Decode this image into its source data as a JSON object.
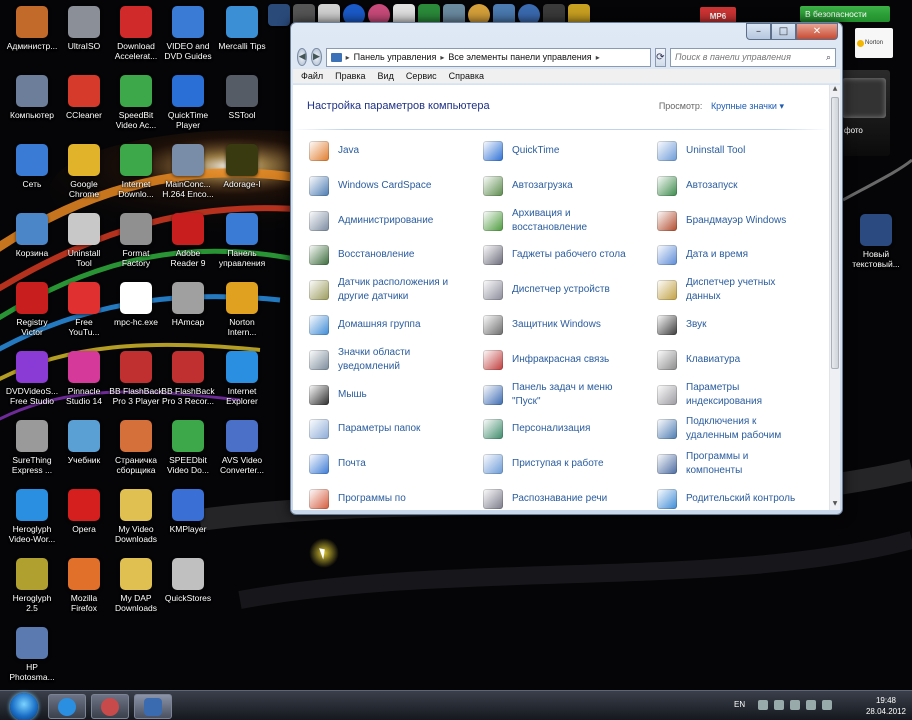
{
  "desktop": {
    "icons": [
      {
        "label": "Администр...",
        "color": "#c26a2a"
      },
      {
        "label": "UltraISO",
        "color": "#8b8f98"
      },
      {
        "label": "Download\nAccelerat...",
        "color": "#d12a2a"
      },
      {
        "label": "VIDEO and\nDVD Guides",
        "color": "#3a7bd5"
      },
      {
        "label": "Mercalli Tips",
        "color": "#3a8fd5"
      },
      {
        "label": "Компьютер",
        "color": "#6c7e99"
      },
      {
        "label": "CCleaner",
        "color": "#d53a2a"
      },
      {
        "label": "SpeedBit\nVideo Ac...",
        "color": "#3ca84a"
      },
      {
        "label": "QuickTime\nPlayer",
        "color": "#2a6fd5"
      },
      {
        "label": "SSTool",
        "color": "#555c66"
      },
      {
        "label": "Сеть",
        "color": "#3a7bd5"
      },
      {
        "label": "Google\nChrome",
        "color": "#e0b32a"
      },
      {
        "label": "Internet\nDownlo...",
        "color": "#3ca84a"
      },
      {
        "label": "MainConc...\nH.264 Enco...",
        "color": "#7a8da8"
      },
      {
        "label": "Adorage-I",
        "color": "#3a3a10"
      },
      {
        "label": "Корзина",
        "color": "#4a86c8"
      },
      {
        "label": "Uninstall\nTool",
        "color": "#c8c8c8"
      },
      {
        "label": "Format\nFactory",
        "color": "#909090"
      },
      {
        "label": "Adobe\nReader 9",
        "color": "#c81e1e"
      },
      {
        "label": "Панель\nуправления",
        "color": "#3a7bd5"
      },
      {
        "label": "Registry\nVictor",
        "color": "#c81e1e"
      },
      {
        "label": "Free\nYouTu...",
        "color": "#e03030"
      },
      {
        "label": "mpc-hc.exe",
        "color": "#ffffff"
      },
      {
        "label": "HAmcap",
        "color": "#a0a0a0"
      },
      {
        "label": "Norton\nIntern...",
        "color": "#e0a020"
      },
      {
        "label": "DVDVideoS...\nFree Studio",
        "color": "#8a3ad5"
      },
      {
        "label": "Pinnacle\nStudio 14",
        "color": "#d53a9a"
      },
      {
        "label": "BB FlashBack\nPro 3 Player",
        "color": "#c03030"
      },
      {
        "label": "BB FlashBack\nPro 3 Recor...",
        "color": "#c03030"
      },
      {
        "label": "Internet\nExplorer",
        "color": "#2a8fe0"
      },
      {
        "label": "SureThing\nExpress ...",
        "color": "#9a9a9a"
      },
      {
        "label": "Учебник",
        "color": "#5aa0d5"
      },
      {
        "label": "Страничка\nсборщика",
        "color": "#d5703a"
      },
      {
        "label": "SPEEDbit\nVideo Do...",
        "color": "#3ca84a"
      },
      {
        "label": "AVS Video\nConverter...",
        "color": "#4a70c8"
      },
      {
        "label": "Heroglyph\nVideo-Wor...",
        "color": "#2a8fe0"
      },
      {
        "label": "Opera",
        "color": "#d51e1e"
      },
      {
        "label": "My Video\nDownloads",
        "color": "#e0c050"
      },
      {
        "label": "KMPlayer",
        "color": "#3a6fd5"
      },
      {
        "label": "Heroglyph\n2.5",
        "color": "#b0a030"
      },
      {
        "label": "Mozilla\nFirefox",
        "color": "#e0702a"
      },
      {
        "label": "My DAP\nDownloads",
        "color": "#e0c050"
      },
      {
        "label": "QuickStores",
        "color": "#c0c0c0"
      },
      {
        "label": "HP\nPhotosma...",
        "color": "#5a7ab0"
      }
    ],
    "right_icon": {
      "label": "Новый\nтекстовый...",
      "color": "#2b4b80"
    },
    "security_badge": "В безопасности",
    "norton_label": "Norton",
    "mp6_label": "MP6",
    "photo_label": "фото"
  },
  "window": {
    "address": {
      "crumb1": "Панель управления",
      "crumb2": "Все элементы панели управления"
    },
    "search_placeholder": "Поиск в панели управления",
    "menu": [
      "Файл",
      "Правка",
      "Вид",
      "Сервис",
      "Справка"
    ],
    "title": "Настройка параметров компьютера",
    "view_by_label": "Просмотр:",
    "view_by_value": "Крупные значки",
    "items": [
      {
        "label": "Java",
        "color": "#e07a2a"
      },
      {
        "label": "QuickTime",
        "color": "#2a6fd5"
      },
      {
        "label": "Uninstall Tool",
        "color": "#6a9ad5"
      },
      {
        "label": "Windows CardSpace",
        "color": "#4a7ab0"
      },
      {
        "label": "Автозагрузка",
        "color": "#5a8a4a"
      },
      {
        "label": "Автозапуск",
        "color": "#3a8a4a"
      },
      {
        "label": "Администрирование",
        "color": "#7a8aa0"
      },
      {
        "label": "Архивация и\nвосстановление",
        "color": "#4a9a3a"
      },
      {
        "label": "Брандмауэр Windows",
        "color": "#b04a2a"
      },
      {
        "label": "Восстановление",
        "color": "#3a6a3a"
      },
      {
        "label": "Гаджеты рабочего стола",
        "color": "#6a6a7a"
      },
      {
        "label": "Дата и время",
        "color": "#5a8ad5"
      },
      {
        "label": "Датчик расположения и\nдругие датчики",
        "color": "#9a9a5a"
      },
      {
        "label": "Диспетчер устройств",
        "color": "#8a8a9a"
      },
      {
        "label": "Диспетчер учетных\nданных",
        "color": "#c0a040"
      },
      {
        "label": "Домашняя группа",
        "color": "#3a8ad5"
      },
      {
        "label": "Защитник Windows",
        "color": "#6a6a6a"
      },
      {
        "label": "Звук",
        "color": "#3a3a3a"
      },
      {
        "label": "Значки области\nуведомлений",
        "color": "#7a8a9a"
      },
      {
        "label": "Инфракрасная связь",
        "color": "#c03a3a"
      },
      {
        "label": "Клавиатура",
        "color": "#8a8a8a"
      },
      {
        "label": "Мышь",
        "color": "#2a2a2a"
      },
      {
        "label": "Панель задач и меню\n\"Пуск\"",
        "color": "#3a6ab0"
      },
      {
        "label": "Параметры\nиндексирования",
        "color": "#9a9aa0"
      },
      {
        "label": "Параметры папок",
        "color": "#8aaad5"
      },
      {
        "label": "Персонализация",
        "color": "#3a8a6a"
      },
      {
        "label": "Подключения к\nудаленным рабочим",
        "color": "#4a7ab0"
      },
      {
        "label": "Почта",
        "color": "#3a7ad5"
      },
      {
        "label": "Приступая к работе",
        "color": "#6a9ad5"
      },
      {
        "label": "Программы и\nкомпоненты",
        "color": "#4a6aa0"
      },
      {
        "label": "Программы по",
        "color": "#d55a3a"
      },
      {
        "label": "Распознавание речи",
        "color": "#7a7a8a"
      },
      {
        "label": "Родительский контроль",
        "color": "#3a8ad5"
      }
    ]
  },
  "taskbar": {
    "lang": "EN",
    "time": "19:48",
    "date": "28.04.2012"
  }
}
